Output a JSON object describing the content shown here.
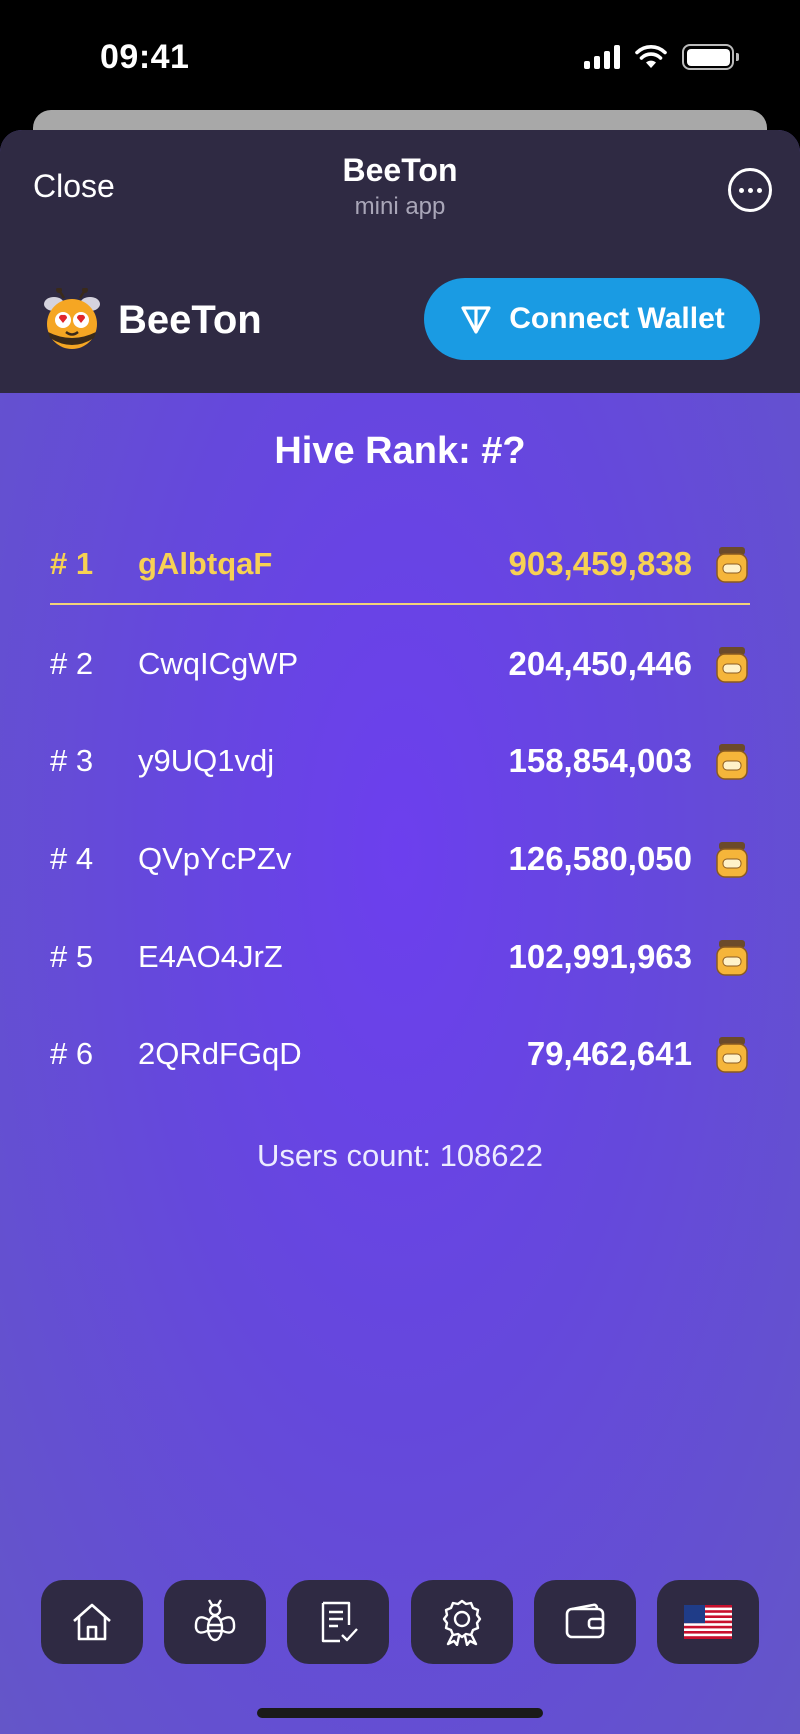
{
  "status_bar": {
    "time": "09:41"
  },
  "header": {
    "close_label": "Close",
    "title": "BeeTon",
    "subtitle": "mini app"
  },
  "brand": {
    "name": "BeeTon"
  },
  "wallet": {
    "connect_label": "Connect Wallet"
  },
  "leaderboard": {
    "title": "Hive Rank: #?",
    "rows": [
      {
        "rank": "# 1",
        "name": "gAlbtqaF",
        "score": "903,459,838"
      },
      {
        "rank": "# 2",
        "name": "CwqICgWP",
        "score": "204,450,446"
      },
      {
        "rank": "# 3",
        "name": "y9UQ1vdj",
        "score": "158,854,003"
      },
      {
        "rank": "# 4",
        "name": "QVpYcPZv",
        "score": "126,580,050"
      },
      {
        "rank": "# 5",
        "name": "E4AO4JrZ",
        "score": "102,991,963"
      },
      {
        "rank": "# 6",
        "name": "2QRdFGqD",
        "score": "79,462,641"
      }
    ],
    "users_count": "Users count: 108622"
  },
  "nav": [
    "home-icon",
    "bee-icon",
    "tasks-icon",
    "award-icon",
    "wallet-icon",
    "us-flag-icon"
  ],
  "colors": {
    "accent": "#1a9be3",
    "header_bg": "#2f2a43",
    "gold": "#f7d153",
    "background": "#6548dc"
  }
}
